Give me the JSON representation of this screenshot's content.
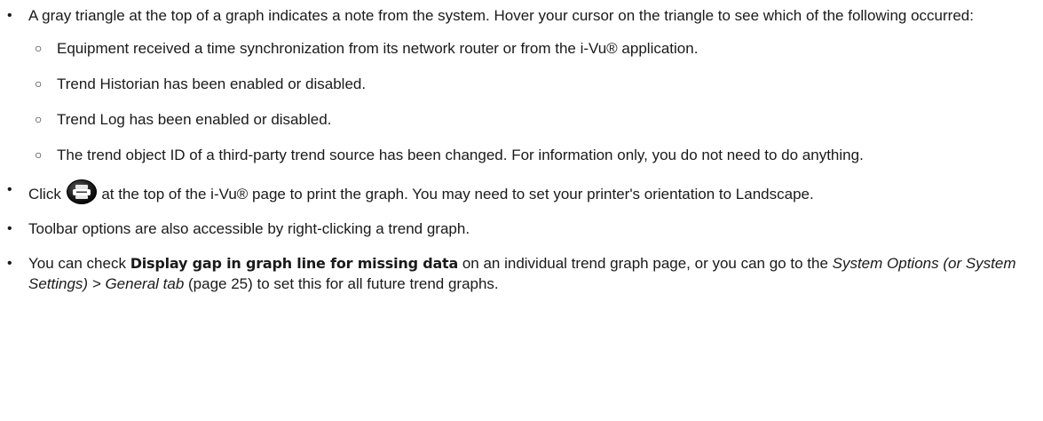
{
  "bullets": {
    "triangle_note": {
      "text": "A gray triangle at the top of a graph indicates a note from the system. Hover your cursor on the triangle to see which of the following occurred:",
      "sub_items": [
        "Equipment received a time synchronization from its network router or from the i-Vu® application.",
        "Trend Historian has been enabled or disabled.",
        "Trend Log has been enabled or disabled.",
        "The trend object ID of a third-party trend source has been changed. For information only, you do not need to do anything."
      ]
    },
    "print": {
      "before_icon": "Click",
      "icon": "print-icon",
      "after_icon": "at the top of the i-Vu® page to print the graph. You may need to set your printer's orientation to Landscape."
    },
    "toolbar": "Toolbar options are also accessible by right-clicking a trend graph.",
    "gap": {
      "part1": "You can check ",
      "bold": "Display gap in graph line for missing data",
      "part2": " on an individual trend graph page, or you can go to the ",
      "italic": "System Options (or System Settings) > General tab",
      "part3": " (page 25) to set this for all future trend graphs."
    }
  }
}
